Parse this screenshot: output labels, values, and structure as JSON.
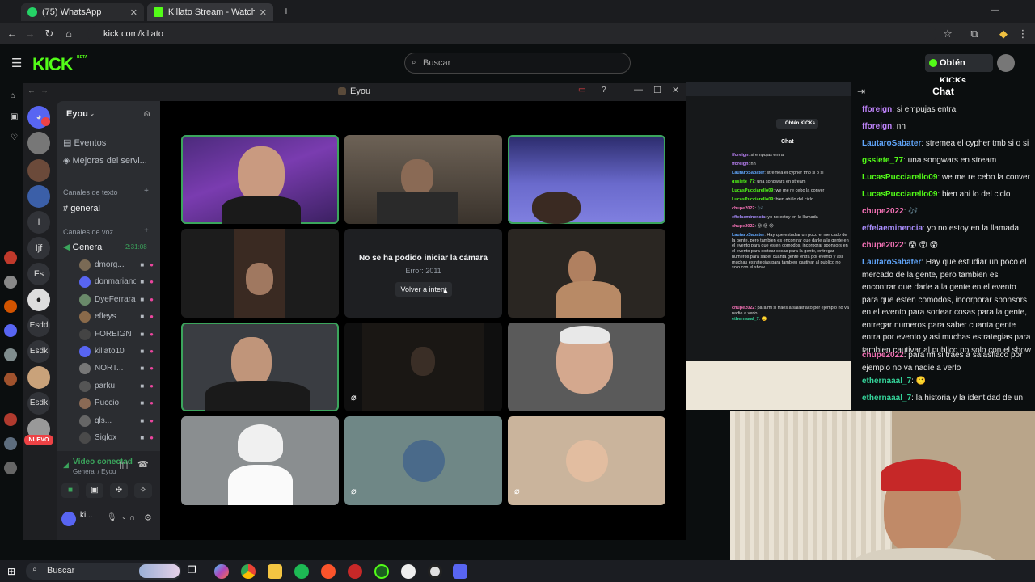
{
  "browser": {
    "tabs": [
      {
        "label": "(75) WhatsApp",
        "active": false
      },
      {
        "label": "Killato Stream - Watch Live on",
        "active": true
      }
    ],
    "new_tab": "+",
    "url": "kick.com/killato"
  },
  "kick": {
    "logo": "KICK",
    "logo_badge": "BETA",
    "search_placeholder": "Buscar",
    "get_kicks": "Obtén KICKs",
    "chat_title": "Chat"
  },
  "discord": {
    "window_title": "Eyou",
    "server_name": "Eyou",
    "channels": {
      "events": "Eventos",
      "boosts": "Mejoras del servi...",
      "text_header": "Canales de texto",
      "text_channel": "general",
      "voice_header": "Canales de voz",
      "voice_channel": "General",
      "voice_time": "2:31:08"
    },
    "voice_users": [
      "dmorg...",
      "donmariano",
      "DyeFerrara",
      "effeys",
      "FOREIGN",
      "killato10",
      "NORT...",
      "parku",
      "Puccio",
      "qls...",
      "Siglox"
    ],
    "new_badge": "NUEVO",
    "server_icons": [
      "I",
      "Ijf",
      "Fs",
      "Esdd",
      "Esdk",
      "Esdk"
    ],
    "video_status": "Vídeo conectad",
    "video_sub": "General / Eyou",
    "user_short": "ki...",
    "camera_error_title": "No se ha podido iniciar la cámara",
    "camera_error_code": "Error: 2011",
    "retry_button": "Volver a intent"
  },
  "chat": {
    "messages": [
      {
        "user": "fforeign",
        "text": "si empujas entra",
        "color": "#c084fc"
      },
      {
        "user": "fforeign",
        "text": "nh",
        "color": "#c084fc"
      },
      {
        "user": "LautaroSabater",
        "text": "stremea el cypher tmb si o si",
        "color": "#60a5fa"
      },
      {
        "user": "gssiete_77",
        "text": "una songwars en stream",
        "color": "#53fc18"
      },
      {
        "user": "LucasPucciarello09",
        "text": "we me re cebo la conver",
        "color": "#53fc18"
      },
      {
        "user": "LucasPucciarello09",
        "text": "bien ahi lo del ciclo",
        "color": "#53fc18"
      },
      {
        "user": "chupe2022",
        "text": "🎶",
        "color": "#f472b6"
      },
      {
        "user": "effelaeminencia",
        "text": "yo no estoy en la llamada",
        "color": "#a78bfa"
      },
      {
        "user": "chupe2022",
        "text": "😵 😵 😵",
        "color": "#f472b6"
      },
      {
        "user": "LautaroSabater",
        "text": "Hay que estudiar un poco el mercado de la gente, pero tambien es encontrar que darle a la gente en el evento para que esten comodos, incorporar sponsors en el evento para sortear cosas para la gente, entregar numeros para saber cuanta gente entra por evento y asi muchas estrategias para tambien cautivar al publico no solo con el show",
        "color": "#60a5fa"
      },
      {
        "user": "chupe2022",
        "text": "para mi si traes a salasflaco por ejemplo no va nadie a verlo",
        "color": "#f472b6"
      },
      {
        "user": "ethernaaal_7",
        "text": "🙂",
        "color": "#34d399"
      },
      {
        "user": "ethernaaal_7",
        "text": "la historia y la identidad de un evento es el gancho",
        "color": "#34d399"
      }
    ]
  },
  "taskbar": {
    "search": "Buscar"
  },
  "colors": {
    "kick_green": "#53fc18",
    "discord_speaking": "#3ba55c",
    "discord_blurple": "#5865f2"
  }
}
